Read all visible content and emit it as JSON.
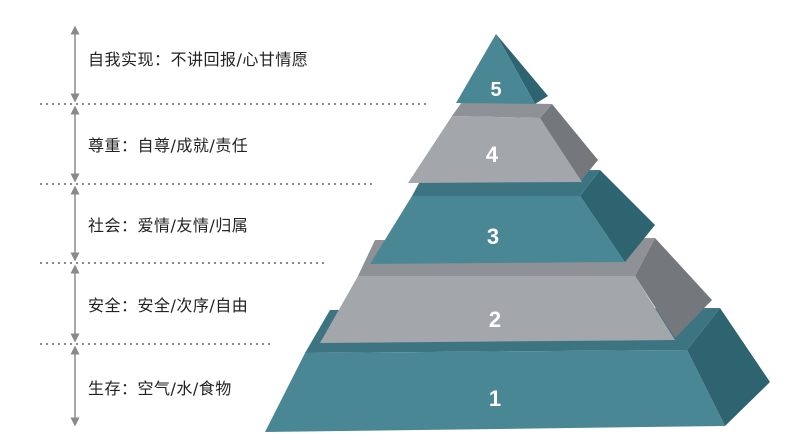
{
  "levels": [
    {
      "number": "5",
      "label": "自我实现：不讲回报/心甘情愿",
      "color": "#4a8795"
    },
    {
      "number": "4",
      "label": "尊重：自尊/成就/责任",
      "color": "#a3a6ab"
    },
    {
      "number": "3",
      "label": "社会：爱情/友情/归属",
      "color": "#4a8795"
    },
    {
      "number": "2",
      "label": "安全：安全/次序/自由",
      "color": "#a3a6ab"
    },
    {
      "number": "1",
      "label": "生存：空气/水/食物",
      "color": "#4a8795"
    }
  ],
  "colors": {
    "teal_front": "#4a8795",
    "teal_side": "#2e6470",
    "gray_front": "#a3a6ab",
    "gray_side": "#74777c",
    "number_text": "#ffffff",
    "divider": "#8a8a8a",
    "arrow": "#8a8a8a"
  }
}
